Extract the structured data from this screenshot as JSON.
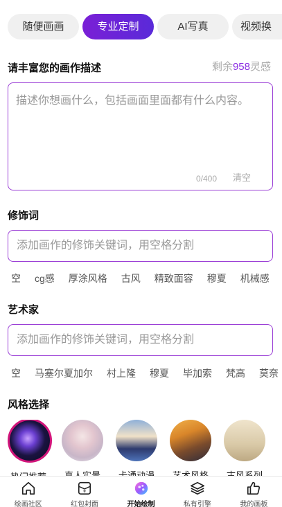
{
  "tabs": [
    {
      "label": "随便画画",
      "active": false
    },
    {
      "label": "专业定制",
      "active": true
    },
    {
      "label": "AI写真",
      "active": false
    },
    {
      "label": "视频换",
      "active": false
    }
  ],
  "description": {
    "title": "请丰富您的画作描述",
    "remaining_prefix": "剩余",
    "remaining_count": "958",
    "remaining_suffix": "灵感",
    "placeholder": "描述你想画什么，包括画面里面都有什么内容。",
    "char_count": "0/400",
    "clear_label": "清空"
  },
  "modifiers": {
    "title": "修饰词",
    "placeholder": "添加画作的修饰关键词，用空格分割",
    "chips": [
      "空",
      "cg感",
      "厚涂风格",
      "古风",
      "精致面容",
      "穆夏",
      "机械感"
    ]
  },
  "artists": {
    "title": "艺术家",
    "placeholder": "添加画作的修饰关键词，用空格分割",
    "chips": [
      "空",
      "马塞尔夏加尔",
      "村上隆",
      "穆夏",
      "毕加索",
      "梵高",
      "莫奈"
    ]
  },
  "styles": {
    "title": "风格选择",
    "items": [
      {
        "label": "热门推荐",
        "selected": true
      },
      {
        "label": "真人实景",
        "selected": false
      },
      {
        "label": "卡通动漫",
        "selected": false
      },
      {
        "label": "艺术风格",
        "selected": false
      },
      {
        "label": "古风系列",
        "selected": false
      }
    ]
  },
  "bottom_nav": [
    {
      "label": "绘画社区",
      "icon": "home-icon",
      "active": false
    },
    {
      "label": "红包封面",
      "icon": "red-envelope-icon",
      "active": false
    },
    {
      "label": "开始绘制",
      "icon": "palette-icon",
      "active": true
    },
    {
      "label": "私有引擎",
      "icon": "layers-icon",
      "active": false
    },
    {
      "label": "我的画板",
      "icon": "thumbs-up-icon",
      "active": false
    }
  ],
  "colors": {
    "accent": "#7a1fd6",
    "border": "#9b3fd6",
    "selected_ring": "#d1147a"
  }
}
